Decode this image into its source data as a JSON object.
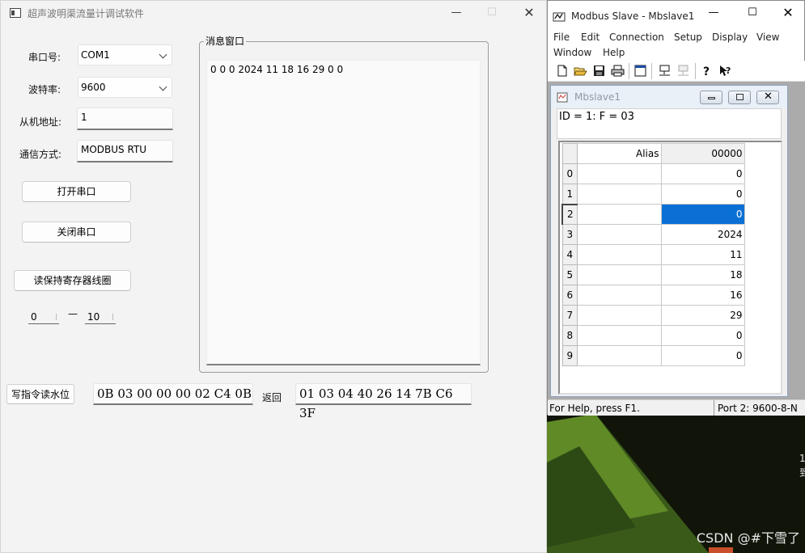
{
  "app": {
    "title": "超声波明渠流量计调试软件",
    "labels": {
      "port": "串口号:",
      "baud": "波特率:",
      "slave": "从机地址:",
      "comm": "通信方式:"
    },
    "port_value": "COM1",
    "baud_value": "9600",
    "slave_value": "1",
    "comm_value": "MODBUS RTU",
    "open_btn": "打开串口",
    "close_btn": "关闭串口",
    "read_btn": "读保持寄存器线圈",
    "range_from": "0",
    "range_dash": "—",
    "range_to": "10",
    "msg_title": "消息窗口",
    "msg_text": "0 0 0 2024 11 18 16 29 0 0",
    "write_btn": "写指令读水位",
    "cmd_hex": "0B 03 00 00 00 02 C4 0B",
    "return_label": "返回",
    "return_hex": "01 03 04 40 26 14 7B C6 3F"
  },
  "modbus": {
    "title": "Modbus Slave - Mbslave1",
    "menu": [
      "File",
      "Edit",
      "Connection",
      "Setup",
      "Display",
      "View",
      "Window",
      "Help"
    ],
    "child_title": "Mbslave1",
    "id_line": "ID = 1: F = 03",
    "header_alias": "Alias",
    "header_addr": "00000",
    "rows": [
      {
        "idx": "0",
        "value": "0"
      },
      {
        "idx": "1",
        "value": "0"
      },
      {
        "idx": "2",
        "value": "0"
      },
      {
        "idx": "3",
        "value": "2024"
      },
      {
        "idx": "4",
        "value": "11"
      },
      {
        "idx": "5",
        "value": "18"
      },
      {
        "idx": "6",
        "value": "16"
      },
      {
        "idx": "7",
        "value": "29"
      },
      {
        "idx": "8",
        "value": "0"
      },
      {
        "idx": "9",
        "value": "0"
      }
    ],
    "selected_row": "2",
    "status_help": "For Help, press F1.",
    "status_port": "Port 2: 9600-8-N"
  },
  "desktop": {
    "watermark": "CSDN @#下雪了",
    "frag1": "1(",
    "frag2": "到"
  },
  "colors": {
    "selection": "#0a70d6",
    "app_bg": "#f3f3f3"
  }
}
